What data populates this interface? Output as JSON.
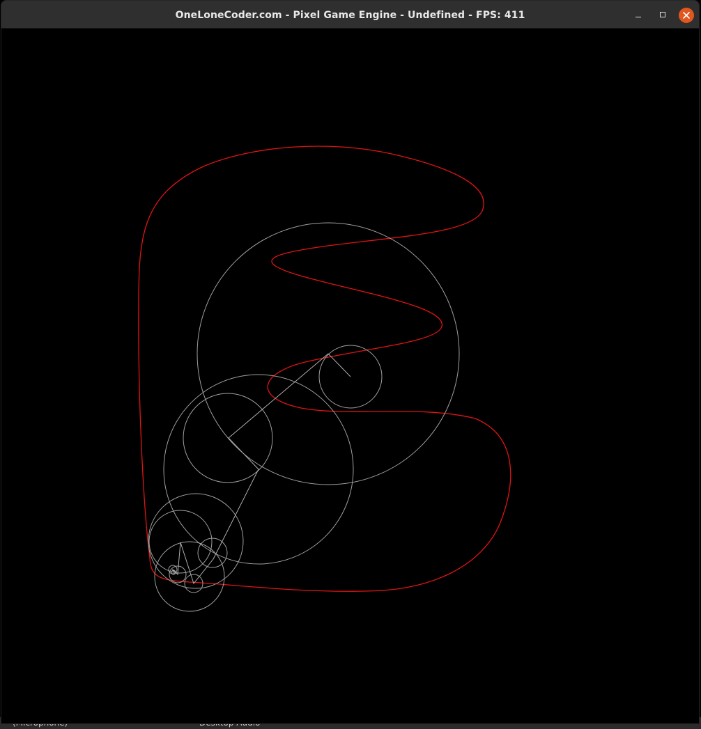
{
  "desktop": {
    "left_hint": "(Microphone)",
    "right_hint": "Desktop Audio"
  },
  "window": {
    "title": "OneLoneCoder.com - Pixel Game Engine - Undefined - FPS: 411",
    "fps": 411
  },
  "colors": {
    "titlebar": "#2f2f2f",
    "canvas": "#000000",
    "trace": "#e11414",
    "circles": "#a0a0a0",
    "close_button": "#e0571f"
  },
  "icons": {
    "minimize": "minimize-icon",
    "maximize": "maximize-icon",
    "close": "close-icon"
  }
}
